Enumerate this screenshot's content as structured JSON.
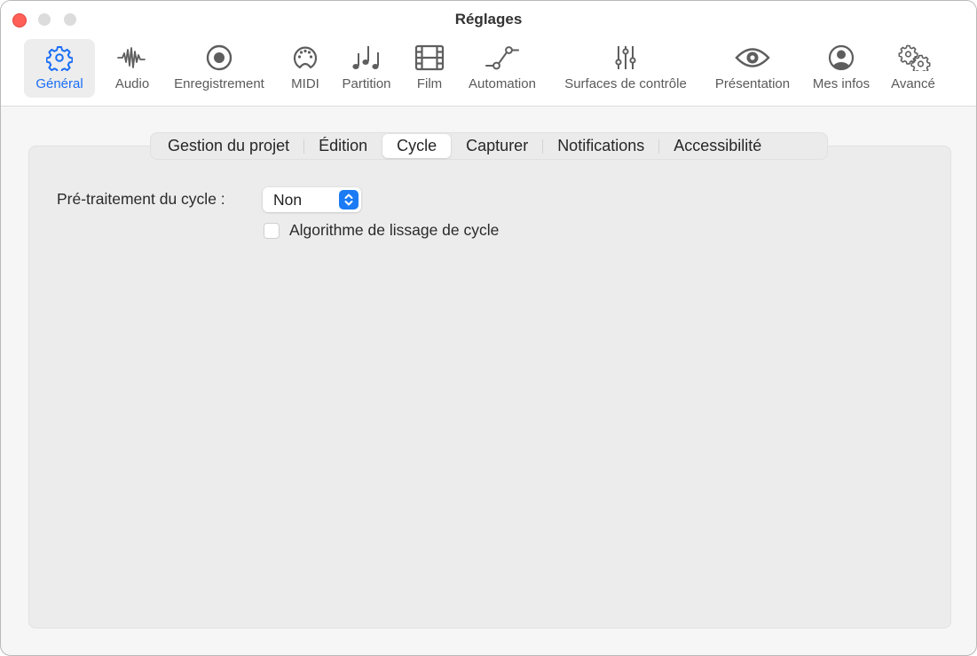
{
  "window": {
    "title": "Réglages",
    "controls": [
      "close",
      "minimize",
      "maximize"
    ]
  },
  "toolbar": {
    "items": [
      {
        "label": "Général",
        "icon": "gear-icon",
        "active": true
      },
      {
        "label": "Audio",
        "icon": "waveform-icon",
        "active": false
      },
      {
        "label": "Enregistrement",
        "icon": "record-icon",
        "active": false
      },
      {
        "label": "MIDI",
        "icon": "midi-connector-icon",
        "active": false
      },
      {
        "label": "Partition",
        "icon": "music-notes-icon",
        "active": false
      },
      {
        "label": "Film",
        "icon": "film-icon",
        "active": false
      },
      {
        "label": "Automation",
        "icon": "automation-curve-icon",
        "active": false
      },
      {
        "label": "Surfaces de contrôle",
        "icon": "sliders-icon",
        "active": false
      },
      {
        "label": "Présentation",
        "icon": "eye-icon",
        "active": false
      },
      {
        "label": "Mes infos",
        "icon": "person-circle-icon",
        "active": false
      },
      {
        "label": "Avancé",
        "icon": "gears-icon",
        "active": false
      }
    ],
    "accent_color": "#1a6ef5"
  },
  "tabs": {
    "items": [
      "Gestion du projet",
      "Édition",
      "Cycle",
      "Capturer",
      "Notifications",
      "Accessibilité"
    ],
    "selected": "Cycle"
  },
  "content": {
    "preprocess_label": "Pré-traitement du cycle :",
    "preprocess_value": "Non",
    "smoothing_label": "Algorithme de lissage de cycle",
    "smoothing_checked": false
  }
}
